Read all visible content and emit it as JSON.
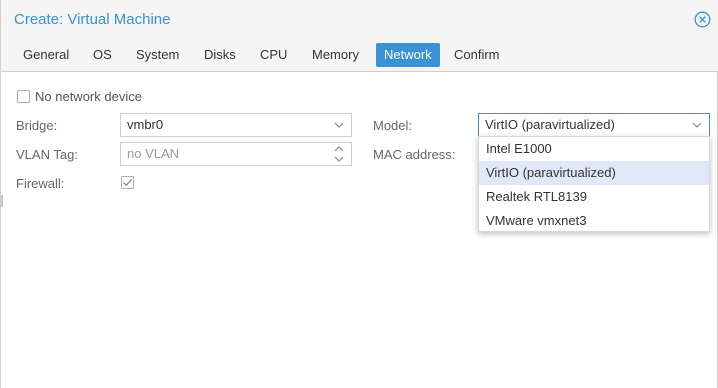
{
  "window": {
    "title": "Create: Virtual Machine"
  },
  "tabs": [
    {
      "label": "General",
      "active": false
    },
    {
      "label": "OS",
      "active": false
    },
    {
      "label": "System",
      "active": false
    },
    {
      "label": "Disks",
      "active": false
    },
    {
      "label": "CPU",
      "active": false
    },
    {
      "label": "Memory",
      "active": false
    },
    {
      "label": "Network",
      "active": true
    },
    {
      "label": "Confirm",
      "active": false
    }
  ],
  "form": {
    "no_network_device": {
      "label": "No network device",
      "checked": false
    },
    "bridge": {
      "label": "Bridge:",
      "value": "vmbr0"
    },
    "vlan_tag": {
      "label": "VLAN Tag:",
      "placeholder": "no VLAN"
    },
    "firewall": {
      "label": "Firewall:",
      "checked": true
    },
    "model": {
      "label": "Model:",
      "value": "VirtIO (paravirtualized)"
    },
    "mac_address": {
      "label": "MAC address:"
    }
  },
  "model_options": [
    "Intel E1000",
    "VirtIO (paravirtualized)",
    "Realtek RTL8139",
    "VMware vmxnet3"
  ],
  "model_options_selected_index": 1,
  "colors": {
    "accent": "#3892d4",
    "title": "#3892d4",
    "selected_option": "#dfe8f6"
  },
  "icons": {
    "close": "close-circle-icon",
    "dropdown": "chevron-down-icon",
    "spinner": "up-down-spinner-icon",
    "check": "check-icon"
  }
}
